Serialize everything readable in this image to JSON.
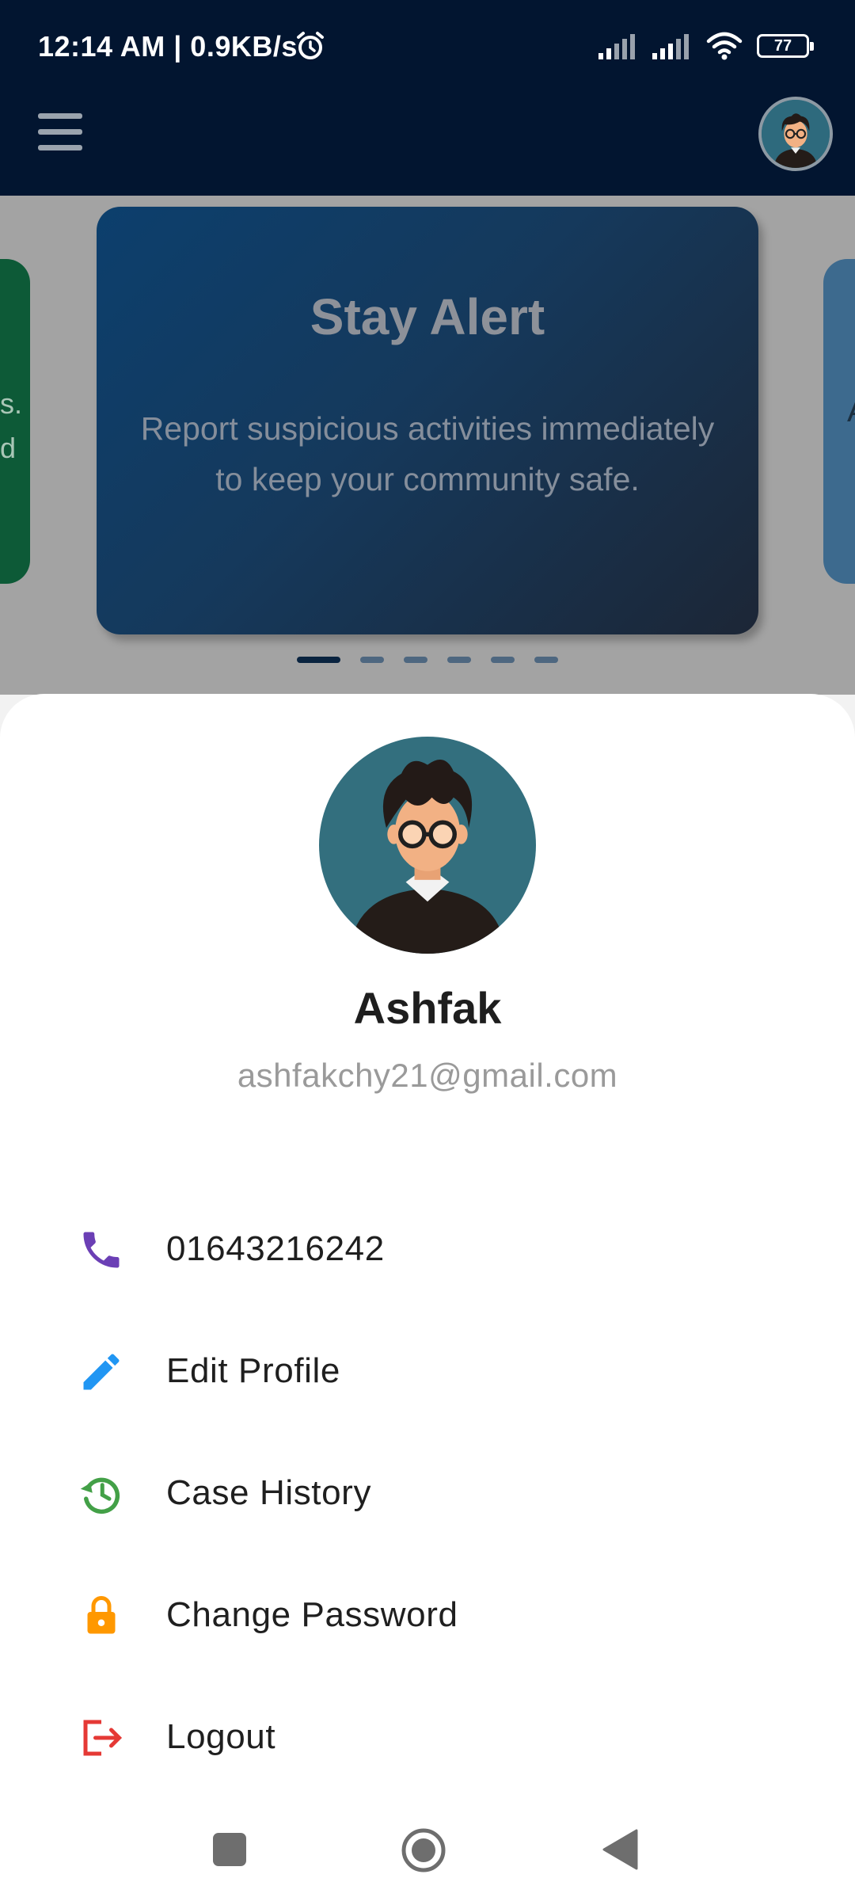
{
  "status_bar": {
    "time": "12:14 AM | 0.9KB/s",
    "battery": "77"
  },
  "carousel": {
    "title": "Stay Alert",
    "text": "Report suspicious activities immediately to keep your community safe.",
    "left_card_fragment": "s.\nd",
    "right_card_fragment": "A",
    "page_count": 6,
    "active_page": 1
  },
  "profile": {
    "name": "Ashfak",
    "email": "ashfakchy21@gmail.com"
  },
  "menu": {
    "phone": "01643216242",
    "edit_profile": "Edit Profile",
    "case_history": "Case History",
    "change_password": "Change Password",
    "logout": "Logout"
  },
  "colors": {
    "app_bar": "#021530",
    "phone_icon": "#6b3fb5",
    "edit_icon": "#2196f3",
    "history_icon": "#43a047",
    "lock_icon": "#ff9800",
    "logout_icon": "#e53935"
  }
}
